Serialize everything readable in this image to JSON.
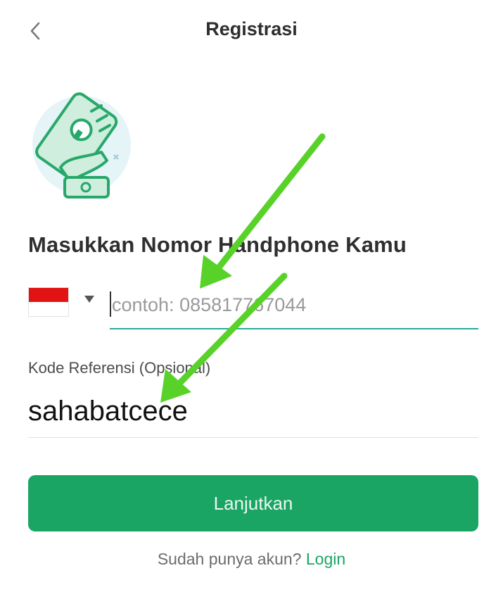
{
  "header": {
    "title": "Registrasi",
    "back_icon": "chevron-left-icon"
  },
  "illustration": {
    "icon": "hand-holding-phone-icon",
    "colors": {
      "bg": "#e4f4f7",
      "accent": "#27a86a",
      "fill": "#cfeedd"
    }
  },
  "form": {
    "heading": "Masukkan Nomor Handphone Kamu",
    "country": {
      "flag": "indonesia-flag-icon",
      "caret_icon": "caret-down-icon"
    },
    "phone": {
      "placeholder": "contoh: 085817767044",
      "value": ""
    },
    "referral": {
      "label": "Kode Referensi (Opsional)",
      "value": "sahabatcece"
    }
  },
  "actions": {
    "continue_label": "Lanjutkan"
  },
  "footer": {
    "prompt": "Sudah punya akun?",
    "login_label": "Login"
  },
  "colors": {
    "primary": "#1aa564",
    "input_underline": "#2aa79b",
    "annotation_arrow": "#58d229"
  }
}
